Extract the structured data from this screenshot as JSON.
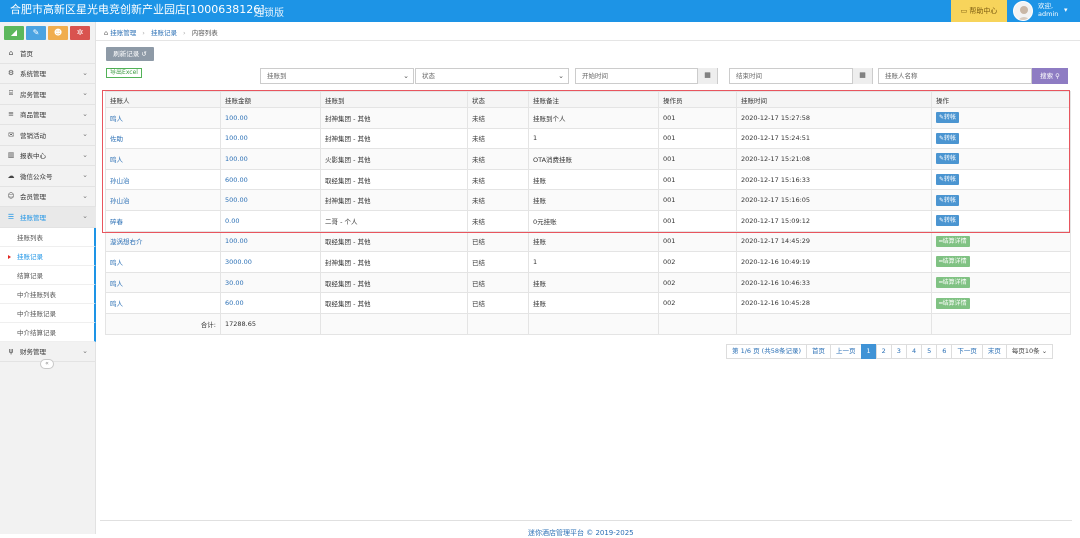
{
  "header": {
    "title": "合肥市高新区星光电竞创新产业园店[1000638126]",
    "edition": "连锁版",
    "help_label": "帮助中心",
    "welcome": "欢迎,",
    "user": "admin"
  },
  "sidebar": {
    "quick_buttons": [
      {
        "icon": "chart-icon",
        "color": "#5cb85c"
      },
      {
        "icon": "pencil-icon",
        "color": "#4ba3e2"
      },
      {
        "icon": "users-icon",
        "color": "#f0ad4e"
      },
      {
        "icon": "gears-icon",
        "color": "#d9534f"
      }
    ],
    "items": [
      {
        "label": "首页",
        "icon": "home-icon"
      },
      {
        "label": "系统管理",
        "icon": "gear-icon"
      },
      {
        "label": "房务管理",
        "icon": "bank-icon"
      },
      {
        "label": "商品管理",
        "icon": "list-icon"
      },
      {
        "label": "营销活动",
        "icon": "gift-icon"
      },
      {
        "label": "报表中心",
        "icon": "bar-chart-icon"
      },
      {
        "label": "微信公众号",
        "icon": "cloud-icon"
      },
      {
        "label": "会员管理",
        "icon": "group-icon"
      },
      {
        "label": "挂账管理",
        "icon": "list-ul-icon"
      },
      {
        "label": "财务管理",
        "icon": "cutlery-icon"
      }
    ],
    "sub_items": [
      {
        "label": "挂账列表"
      },
      {
        "label": "挂账记录"
      },
      {
        "label": "结算记录"
      },
      {
        "label": "中介挂账列表"
      },
      {
        "label": "中介挂账记录"
      },
      {
        "label": "中介结算记录"
      }
    ]
  },
  "breadcrumb": {
    "items": [
      "挂账管理",
      "挂账记录",
      "内容列表"
    ]
  },
  "toolbar": {
    "back_label": "刷新记录",
    "excel_label": "导出Excel"
  },
  "filters": {
    "account_placeholder": "挂账到",
    "status_placeholder": "状态",
    "start_placeholder": "开始时间",
    "end_placeholder": "结束时间",
    "name_placeholder": "挂账人名称",
    "search_label": "搜索"
  },
  "table": {
    "headers": [
      "挂账人",
      "挂账金额",
      "挂账到",
      "状态",
      "挂账备注",
      "操作员",
      "挂账时间",
      "操作"
    ],
    "rows": [
      {
        "name": "鸣人",
        "amount": "100.00",
        "to": "封神集团 - 其他",
        "status": "未结",
        "note": "挂账到个人",
        "operator": "001",
        "time": "2020-12-17 15:27:58",
        "action": "转帐"
      },
      {
        "name": "佐助",
        "amount": "100.00",
        "to": "封神集团 - 其他",
        "status": "未结",
        "note": "1",
        "operator": "001",
        "time": "2020-12-17 15:24:51",
        "action": "转帐"
      },
      {
        "name": "鸣人",
        "amount": "100.00",
        "to": "火影集团 - 其他",
        "status": "未结",
        "note": "OTA消费挂账",
        "operator": "001",
        "time": "2020-12-17 15:21:08",
        "action": "转帐"
      },
      {
        "name": "孙山治",
        "amount": "600.00",
        "to": "取经集团 - 其他",
        "status": "未结",
        "note": "挂账",
        "operator": "001",
        "time": "2020-12-17 15:16:33",
        "action": "转帐"
      },
      {
        "name": "孙山治",
        "amount": "500.00",
        "to": "封神集团 - 其他",
        "status": "未结",
        "note": "挂账",
        "operator": "001",
        "time": "2020-12-17 15:16:05",
        "action": "转帐"
      },
      {
        "name": "碎春",
        "amount": "0.00",
        "to": "二哥 - 个人",
        "status": "未结",
        "note": "0元挂账",
        "operator": "001",
        "time": "2020-12-17 15:09:12",
        "action": "转帐"
      },
      {
        "name": "漩涡想右介",
        "amount": "100.00",
        "to": "取经集团 - 其他",
        "status": "已结",
        "note": "挂账",
        "operator": "001",
        "time": "2020-12-17 14:45:29",
        "action": "结算详情"
      },
      {
        "name": "鸣人",
        "amount": "3000.00",
        "to": "封神集团 - 其他",
        "status": "已结",
        "note": "1",
        "operator": "002",
        "time": "2020-12-16 10:49:19",
        "action": "结算详情"
      },
      {
        "name": "鸣人",
        "amount": "30.00",
        "to": "取经集团 - 其他",
        "status": "已结",
        "note": "挂账",
        "operator": "002",
        "time": "2020-12-16 10:46:33",
        "action": "结算详情"
      },
      {
        "name": "鸣人",
        "amount": "60.00",
        "to": "取经集团 - 其他",
        "status": "已结",
        "note": "挂账",
        "operator": "002",
        "time": "2020-12-16 10:45:28",
        "action": "结算详情"
      }
    ],
    "total_label": "合计:",
    "total_value": "17288.65"
  },
  "pagination": {
    "info": "第 1/6 页 (共58条记录)",
    "first": "首页",
    "prev": "上一页",
    "pages": [
      "1",
      "2",
      "3",
      "4",
      "5",
      "6"
    ],
    "next": "下一页",
    "last": "末页",
    "page_size": "每页10条"
  },
  "footer": {
    "text": "迷你酒店管理平台 © 2019-2025"
  }
}
